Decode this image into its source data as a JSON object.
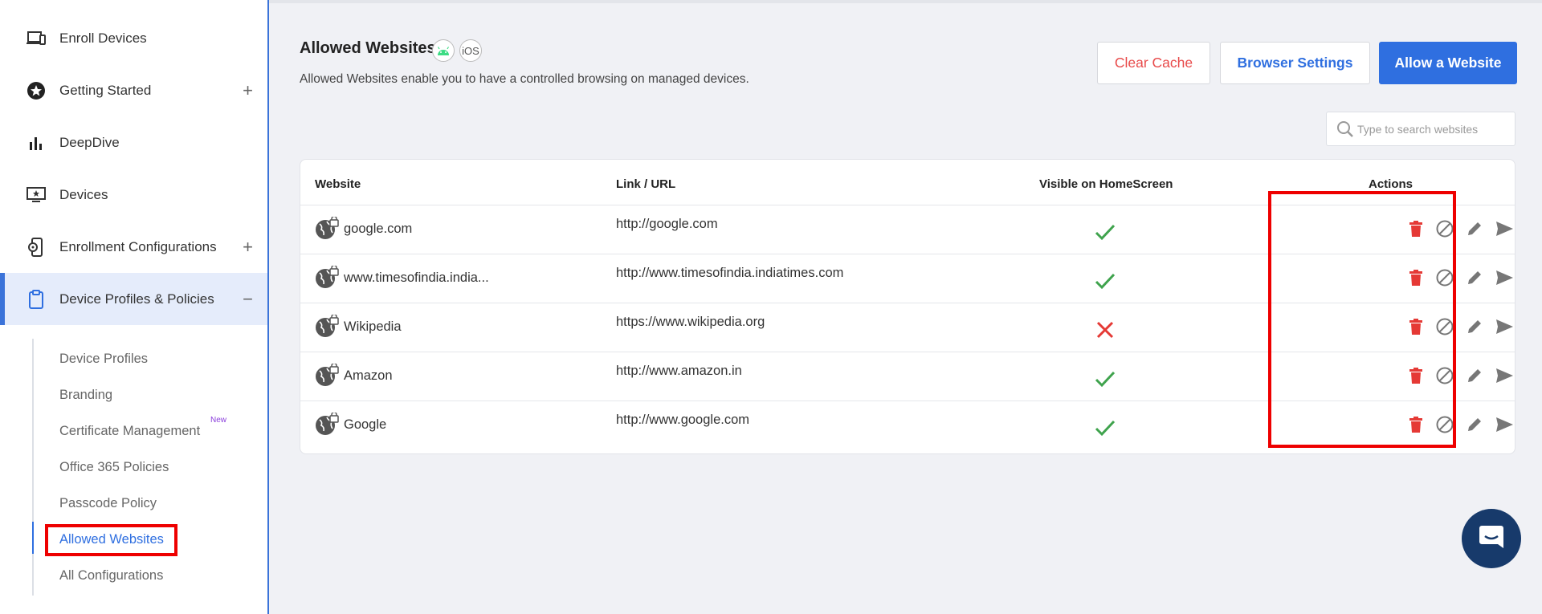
{
  "sidebar": {
    "items": [
      {
        "label": "Enroll Devices",
        "icon": "devices-icon",
        "toggle": ""
      },
      {
        "label": "Getting Started",
        "icon": "star-icon",
        "toggle": "+"
      },
      {
        "label": "DeepDive",
        "icon": "bar-chart-icon",
        "toggle": ""
      },
      {
        "label": "Devices",
        "icon": "monitor-icon",
        "toggle": ""
      },
      {
        "label": "Enrollment Configurations",
        "icon": "phone-settings-icon",
        "toggle": "+"
      },
      {
        "label": "Device Profiles & Policies",
        "icon": "clipboard-icon",
        "toggle": "−"
      }
    ],
    "sub_items": [
      {
        "label": "Device Profiles"
      },
      {
        "label": "Branding"
      },
      {
        "label": "Certificate Management"
      },
      {
        "label": "Office 365 Policies"
      },
      {
        "label": "Passcode Policy"
      },
      {
        "label": "Allowed Websites"
      },
      {
        "label": "All Configurations"
      }
    ],
    "new_tag": "New"
  },
  "header": {
    "title": "Allowed Websites",
    "ios_label": "iOS",
    "subtitle": "Allowed Websites enable you to have a controlled browsing on managed devices."
  },
  "toolbar": {
    "clear_cache": "Clear Cache",
    "browser_settings": "Browser Settings",
    "allow_website": "Allow a Website"
  },
  "search": {
    "placeholder": "Type to search websites"
  },
  "table": {
    "headers": {
      "website": "Website",
      "url": "Link / URL",
      "visible": "Visible on HomeScreen",
      "actions": "Actions"
    },
    "rows": [
      {
        "name": "google.com",
        "url": "http://google.com",
        "visible": true
      },
      {
        "name": "www.timesofindia.india...",
        "url": "http://www.timesofindia.indiatimes.com",
        "visible": true
      },
      {
        "name": "Wikipedia",
        "url": "https://www.wikipedia.org",
        "visible": false
      },
      {
        "name": "Amazon",
        "url": "http://www.amazon.in",
        "visible": true
      },
      {
        "name": "Google",
        "url": "http://www.google.com",
        "visible": true
      }
    ]
  },
  "colors": {
    "accent": "#2f6fe0",
    "danger": "#e84a4a",
    "success": "#3fa34d",
    "highlight": "#ee0000"
  }
}
